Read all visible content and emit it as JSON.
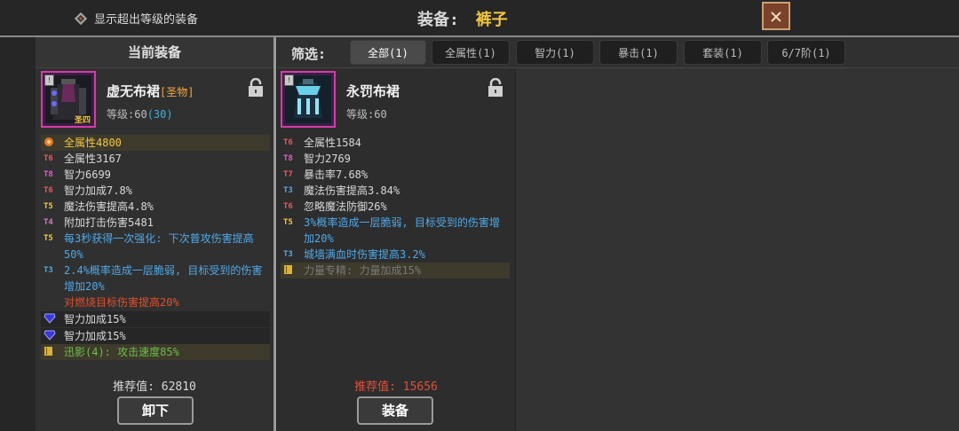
{
  "header": {
    "toggle_label": "显示超出等级的装备",
    "title_label": "装备:",
    "title_value": "裤子",
    "close_glyph": "✕"
  },
  "left": {
    "panel_title": "当前装备",
    "item": {
      "name": "虚无布裙",
      "tag": "[圣物]",
      "badge": "圣四",
      "level_label": "等级:60",
      "level_extra": "(30)"
    },
    "stats": [
      {
        "tier": "",
        "text": "全属性4800",
        "color": "#f2c640",
        "tier_color": "#e07a2a",
        "style": "hl",
        "icon": "orb"
      },
      {
        "tier": "T6",
        "text": "全属性3167",
        "color": "#d9d9d9",
        "tier_color": "#e85a5a"
      },
      {
        "tier": "T8",
        "text": "智力6699",
        "color": "#d9d9d9",
        "tier_color": "#e05acb"
      },
      {
        "tier": "T6",
        "text": "智力加成7.8%",
        "color": "#d9d9d9",
        "tier_color": "#e85a5a"
      },
      {
        "tier": "T5",
        "text": "魔法伤害提高4.8%",
        "color": "#d9d9d9",
        "tier_color": "#f2c640"
      },
      {
        "tier": "T4",
        "text": "附加打击伤害5481",
        "color": "#d9d9d9",
        "tier_color": "#d27acb"
      },
      {
        "tier": "T5",
        "text": "每3秒获得一次强化: 下次普攻伤害提高50%",
        "color": "#4fa9e8",
        "tier_color": "#f2c640"
      },
      {
        "tier": "T3",
        "text": "2.4%概率造成一层脆弱, 目标受到的伤害增加20%",
        "color": "#4fa9e8",
        "tier_color": "#4fa9e8"
      },
      {
        "tier": "",
        "text": "对燃烧目标伤害提高20%",
        "color": "#e0502e",
        "tier_color": "#e0502e"
      },
      {
        "tier": "",
        "text": "智力加成15%",
        "color": "#d9d9d9",
        "tier_color": "#6a6aff",
        "style": "gem",
        "icon": "gem"
      },
      {
        "tier": "",
        "text": "智力加成15%",
        "color": "#d9d9d9",
        "tier_color": "#6a6aff",
        "style": "gem",
        "icon": "gem"
      },
      {
        "tier": "",
        "text": "迅影(4): 攻击速度85%",
        "color": "#6cbf4a",
        "tier_color": "#d8b23a",
        "style": "hl",
        "icon": "book"
      }
    ],
    "recommend": "推荐值: 62810",
    "button": "卸下"
  },
  "filter": {
    "label": "筛选:",
    "tabs": [
      "全部(1)",
      "全属性(1)",
      "智力(1)",
      "暴击(1)",
      "套装(1)",
      "6/7阶(1)"
    ],
    "active_index": 0
  },
  "mid": {
    "item": {
      "name": "永罚布裙",
      "level_label": "等级:60"
    },
    "stats": [
      {
        "tier": "T6",
        "text": "全属性1584",
        "color": "#d9d9d9",
        "tier_color": "#e85a5a"
      },
      {
        "tier": "T8",
        "text": "智力2769",
        "color": "#d9d9d9",
        "tier_color": "#e05acb"
      },
      {
        "tier": "T7",
        "text": "暴击率7.68%",
        "color": "#d9d9d9",
        "tier_color": "#e85a5a"
      },
      {
        "tier": "T3",
        "text": "魔法伤害提高3.84%",
        "color": "#d9d9d9",
        "tier_color": "#4fa9e8"
      },
      {
        "tier": "T6",
        "text": "忽略魔法防御26%",
        "color": "#d9d9d9",
        "tier_color": "#e85a5a"
      },
      {
        "tier": "T5",
        "text": "3%概率造成一层脆弱, 目标受到的伤害增加20%",
        "color": "#4fa9e8",
        "tier_color": "#f2c640"
      },
      {
        "tier": "T3",
        "text": "城墙满血时伤害提高3.2%",
        "color": "#4fa9e8",
        "tier_color": "#4fa9e8"
      },
      {
        "tier": "",
        "text": "力量专精: 力量加成15%",
        "color": "#7a7a7a",
        "tier_color": "#d8b23a",
        "style": "hl",
        "icon": "book"
      }
    ],
    "recommend": "推荐值: 15656",
    "button": "装备"
  }
}
